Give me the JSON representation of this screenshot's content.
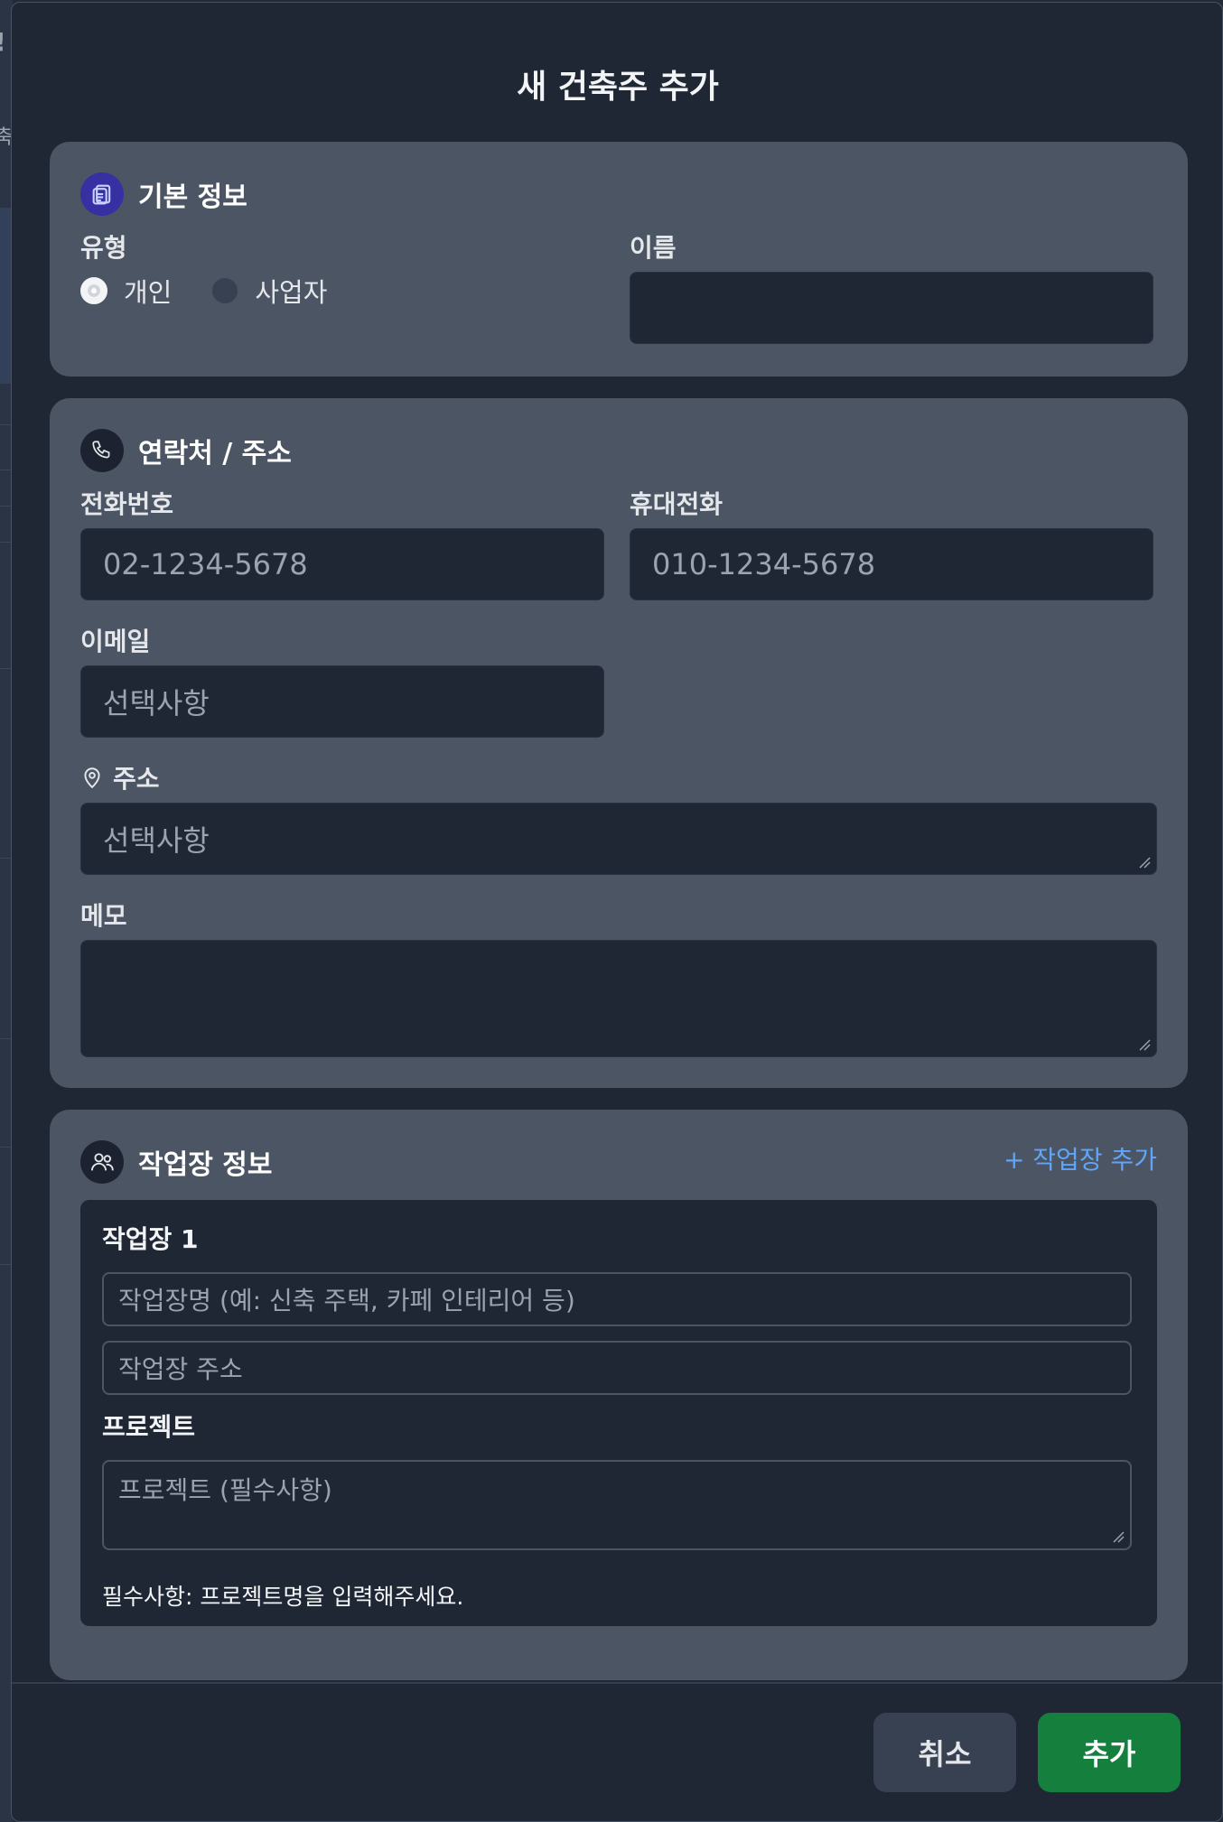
{
  "background": {
    "glyphs": [
      "!",
      "축"
    ]
  },
  "modal": {
    "title": "새 건축주 추가"
  },
  "basic": {
    "title": "기본 정보",
    "icon": "clipboard-icon",
    "type_label": "유형",
    "type_options": [
      {
        "label": "개인",
        "selected": true
      },
      {
        "label": "사업자",
        "selected": false
      }
    ],
    "name_label": "이름",
    "name_value": ""
  },
  "contact": {
    "title": "연락처 / 주소",
    "icon": "phone-icon",
    "phone_label": "전화번호",
    "phone_placeholder": "02-1234-5678",
    "mobile_label": "휴대전화",
    "mobile_placeholder": "010-1234-5678",
    "email_label": "이메일",
    "email_placeholder": "선택사항",
    "address_label": "주소",
    "address_icon": "map-pin-icon",
    "address_placeholder": "선택사항",
    "memo_label": "메모",
    "memo_value": ""
  },
  "sites": {
    "title": "작업장 정보",
    "icon": "users-icon",
    "add_label": "+ 작업장 추가",
    "items": [
      {
        "title": "작업장 1",
        "name_placeholder": "작업장명 (예: 신축 주택, 카페 인테리어 등)",
        "address_placeholder": "작업장 주소",
        "project_label": "프로젝트",
        "project_placeholder": "프로젝트 (필수사항)",
        "note": "필수사항: 프로젝트명을 입력해주세요."
      }
    ]
  },
  "footer": {
    "cancel_label": "취소",
    "submit_label": "추가"
  },
  "colors": {
    "accent_link": "#60a5fa",
    "submit_green": "#15803d",
    "section_bg": "#4b5563",
    "modal_bg": "#1f2735"
  }
}
